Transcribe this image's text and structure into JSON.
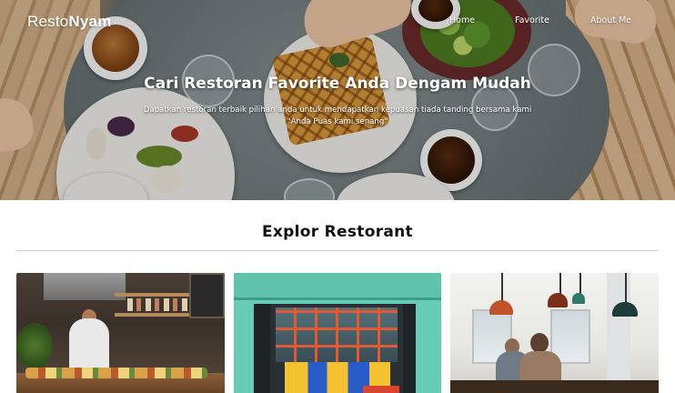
{
  "brand": {
    "part1": "Resto",
    "part2": "Nyam"
  },
  "nav": {
    "items": [
      "Home",
      "Favorite",
      "About Me"
    ]
  },
  "hero": {
    "title": "Cari Restoran Favorite Anda Dengam Mudah",
    "subtitle_line1": "Dapatkan restoran terbaik pilihan anda untuk mendapatkan kepuasan tiada tanding bersama kami",
    "subtitle_line2": "\"Anda Puas kami senang\""
  },
  "section": {
    "title": "Explor Restorant"
  },
  "colors": {
    "hero_text": "#ffffff",
    "heading": "#111111",
    "rule": "#cfcfcf"
  },
  "cards": [
    {
      "image": "kitchen-photo"
    },
    {
      "image": "storefront-photo"
    },
    {
      "image": "cafe-interior-photo"
    }
  ]
}
